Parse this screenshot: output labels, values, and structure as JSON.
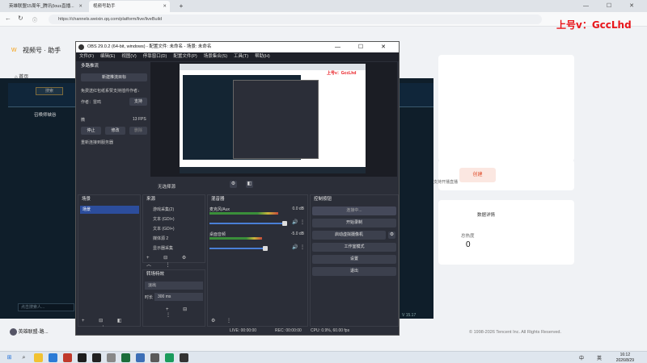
{
  "browser": {
    "tabs": [
      {
        "label": "英雄联盟15周年_腾讯(lous直播...",
        "active": false
      },
      {
        "label": "视频号助手",
        "active": true
      }
    ],
    "new_tab": "+",
    "url": "https://channels.weixin.qq.com/platform/live/liveBuild"
  },
  "overlay_text": "上号v：GccLhd",
  "page": {
    "brand": "视频号 · 助手",
    "home": "首页",
    "create_btn": "创建",
    "hint": "支持开播直播",
    "data_detail": "数据详情",
    "hotness_label": "总热度",
    "hotness_value": "0",
    "copyright": "© 1998-2026 Tencent Inc. All Rights Reserved.",
    "game_search_placeholder": "搜索",
    "game_label": "召唤师峡谷",
    "game_search2": "点击搜索人...",
    "game_version": "V 15.17",
    "footer_left": "英雄联盟-路..."
  },
  "obs": {
    "title": "OBS 29.0.2 (64-bit, windows) - 配置文件: 未命名 - 场景: 未命名",
    "menu": [
      "文件(F)",
      "编辑(E)",
      "视图(V)",
      "停靠窗口(D)",
      "配置文件(P)",
      "场景集合(S)",
      "工具(T)",
      "帮助(H)"
    ],
    "multistream": {
      "title": "多路推流",
      "new_target": "新建推流目标",
      "free_text": "免费送红包纸系赞支持插件作者↓",
      "author": "作者：雷鸣",
      "support": "支持",
      "stream_name": "微",
      "fps": "13 FPS",
      "stop": "停止",
      "edit": "修改",
      "delete": "删除",
      "reconnect": "重新连接到服务器"
    },
    "no_source": "无选择源",
    "scenes": {
      "title": "场景",
      "items": [
        "场景"
      ]
    },
    "sources": {
      "title": "来源",
      "items": [
        "游戏采集(2)",
        "文本 (GDI+)",
        "文本 (GDI+)",
        "媒体源 2",
        "显示器采集"
      ]
    },
    "mixer": {
      "title": "混音器",
      "channels": [
        {
          "name": "麦克风/Aux",
          "db": "0.0 dB",
          "level": 0.72
        },
        {
          "name": "桌面音频",
          "db": "-5.0 dB",
          "level": 0.55
        }
      ],
      "scale": [
        "-60",
        "-55",
        "-50",
        "-45",
        "-40",
        "-35",
        "-30",
        "-25",
        "-20",
        "-15",
        "-10",
        "-5",
        "0"
      ]
    },
    "controls": {
      "title": "控制按钮",
      "buttons": [
        "连接中...",
        "开始录制",
        "启动虚拟摄像机",
        "工作室模式",
        "设置",
        "退出"
      ]
    },
    "transitions": {
      "title": "转场特效",
      "type": "淡出",
      "duration_label": "时长",
      "duration": "300 ms"
    },
    "status": {
      "live": "LIVE: 00:00:00",
      "rec": "REC: 00:00:00",
      "cpu": "CPU: 0.9%, 60.00 fps"
    }
  },
  "taskbar": {
    "time": "16:12",
    "date": "2026/8/29",
    "ime": "中",
    "lang": "英"
  }
}
